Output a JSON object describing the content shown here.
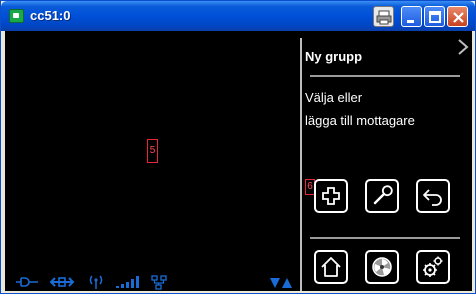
{
  "window": {
    "title": "cc51:0"
  },
  "panel": {
    "header": "Ny grupp",
    "line1": "Välja eller",
    "line2": "lägga till mottagare"
  },
  "markers": {
    "main_area": "5",
    "add_button": "6"
  },
  "icons": {
    "top_row": [
      "plus-icon",
      "wrench-icon",
      "back-arrow-icon"
    ],
    "bottom_row": [
      "home-icon",
      "fan-icon",
      "gears-icon"
    ],
    "status": [
      "power-plug-icon",
      "network-link-icon",
      "antenna-icon",
      "signal-bars-icon",
      "network-tree-icon",
      "scroll-arrows-icon"
    ]
  },
  "colors": {
    "background": "#000000",
    "text": "#ffffff",
    "status_icon": "#1a6bd6",
    "marker": "#e8253b"
  }
}
